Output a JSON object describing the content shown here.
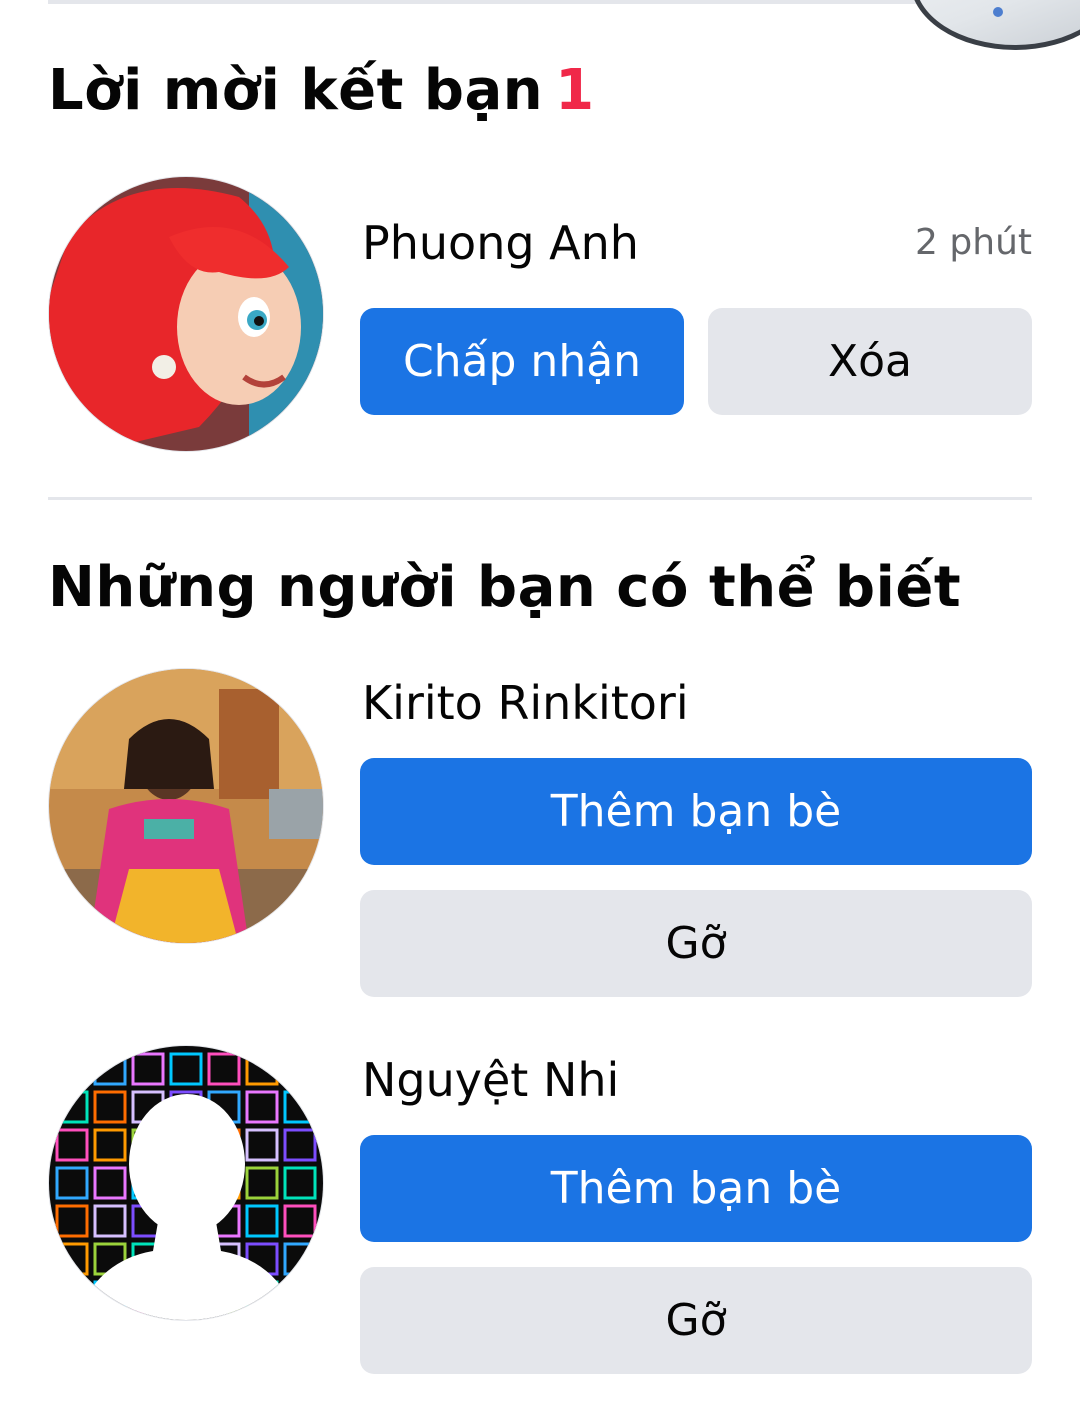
{
  "friend_requests": {
    "heading": "Lời mời kết bạn",
    "count": "1",
    "items": [
      {
        "name": "Phuong Anh",
        "time": "2 phút",
        "accept_label": "Chấp nhận",
        "delete_label": "Xóa"
      }
    ]
  },
  "suggestions": {
    "heading": "Những người bạn có thể biết",
    "items": [
      {
        "name": "Kirito Rinkitori",
        "add_label": "Thêm bạn bè",
        "remove_label": "Gỡ"
      },
      {
        "name": "Nguyệt Nhi",
        "add_label": "Thêm bạn bè",
        "remove_label": "Gỡ"
      }
    ]
  },
  "colors": {
    "primary_button": "#1b74e4",
    "secondary_button": "#e4e6eb",
    "badge": "#f02849",
    "muted_text": "#65676b"
  },
  "icons": {
    "default_avatar": "person-silhouette-icon"
  }
}
